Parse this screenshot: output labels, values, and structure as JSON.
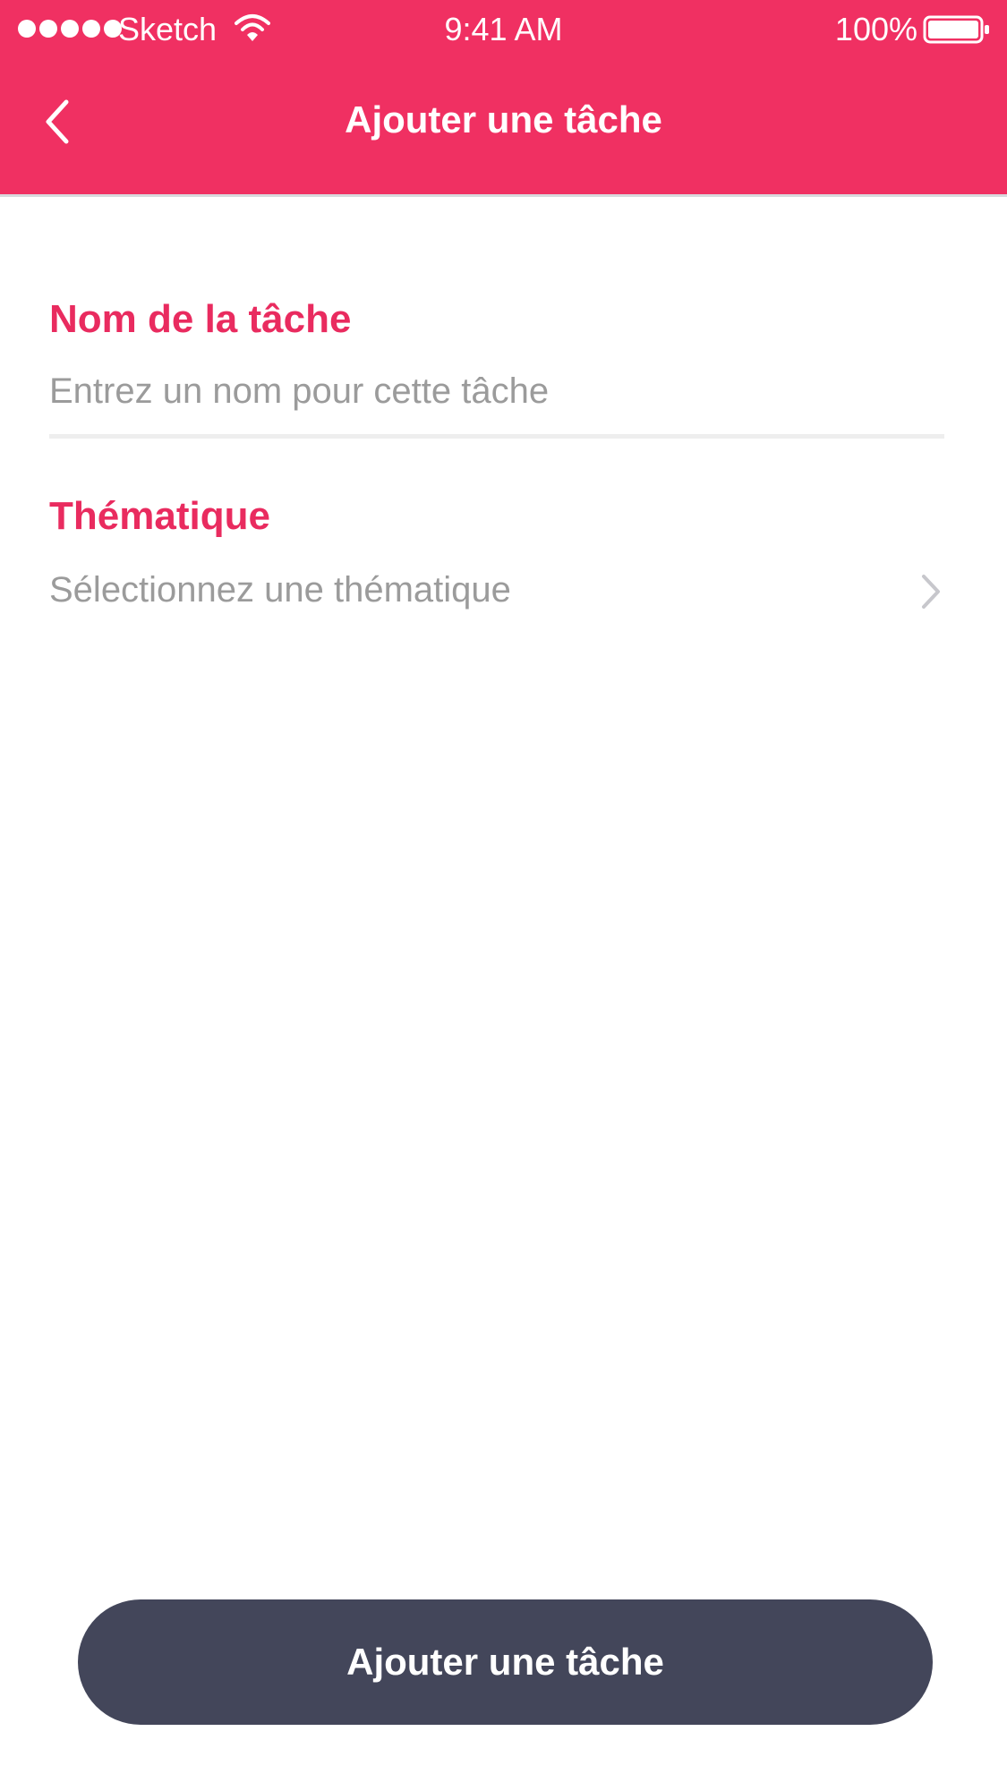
{
  "status_bar": {
    "carrier": "Sketch",
    "time": "9:41 AM",
    "battery": "100%"
  },
  "nav": {
    "title": "Ajouter une tâche",
    "back_icon": "chevron-left-icon"
  },
  "form": {
    "name_label": "Nom de la tâche",
    "name_placeholder": "Entrez un nom pour cette tâche",
    "name_value": "",
    "theme_label": "Thématique",
    "theme_placeholder": "Sélectionnez une thématique",
    "theme_icon": "chevron-right-icon"
  },
  "actions": {
    "submit_label": "Ajouter une tâche"
  },
  "colors": {
    "header_bg": "#f03062",
    "label": "#e92b5f",
    "placeholder": "#9b9b9b",
    "button_bg": "#43465a"
  }
}
